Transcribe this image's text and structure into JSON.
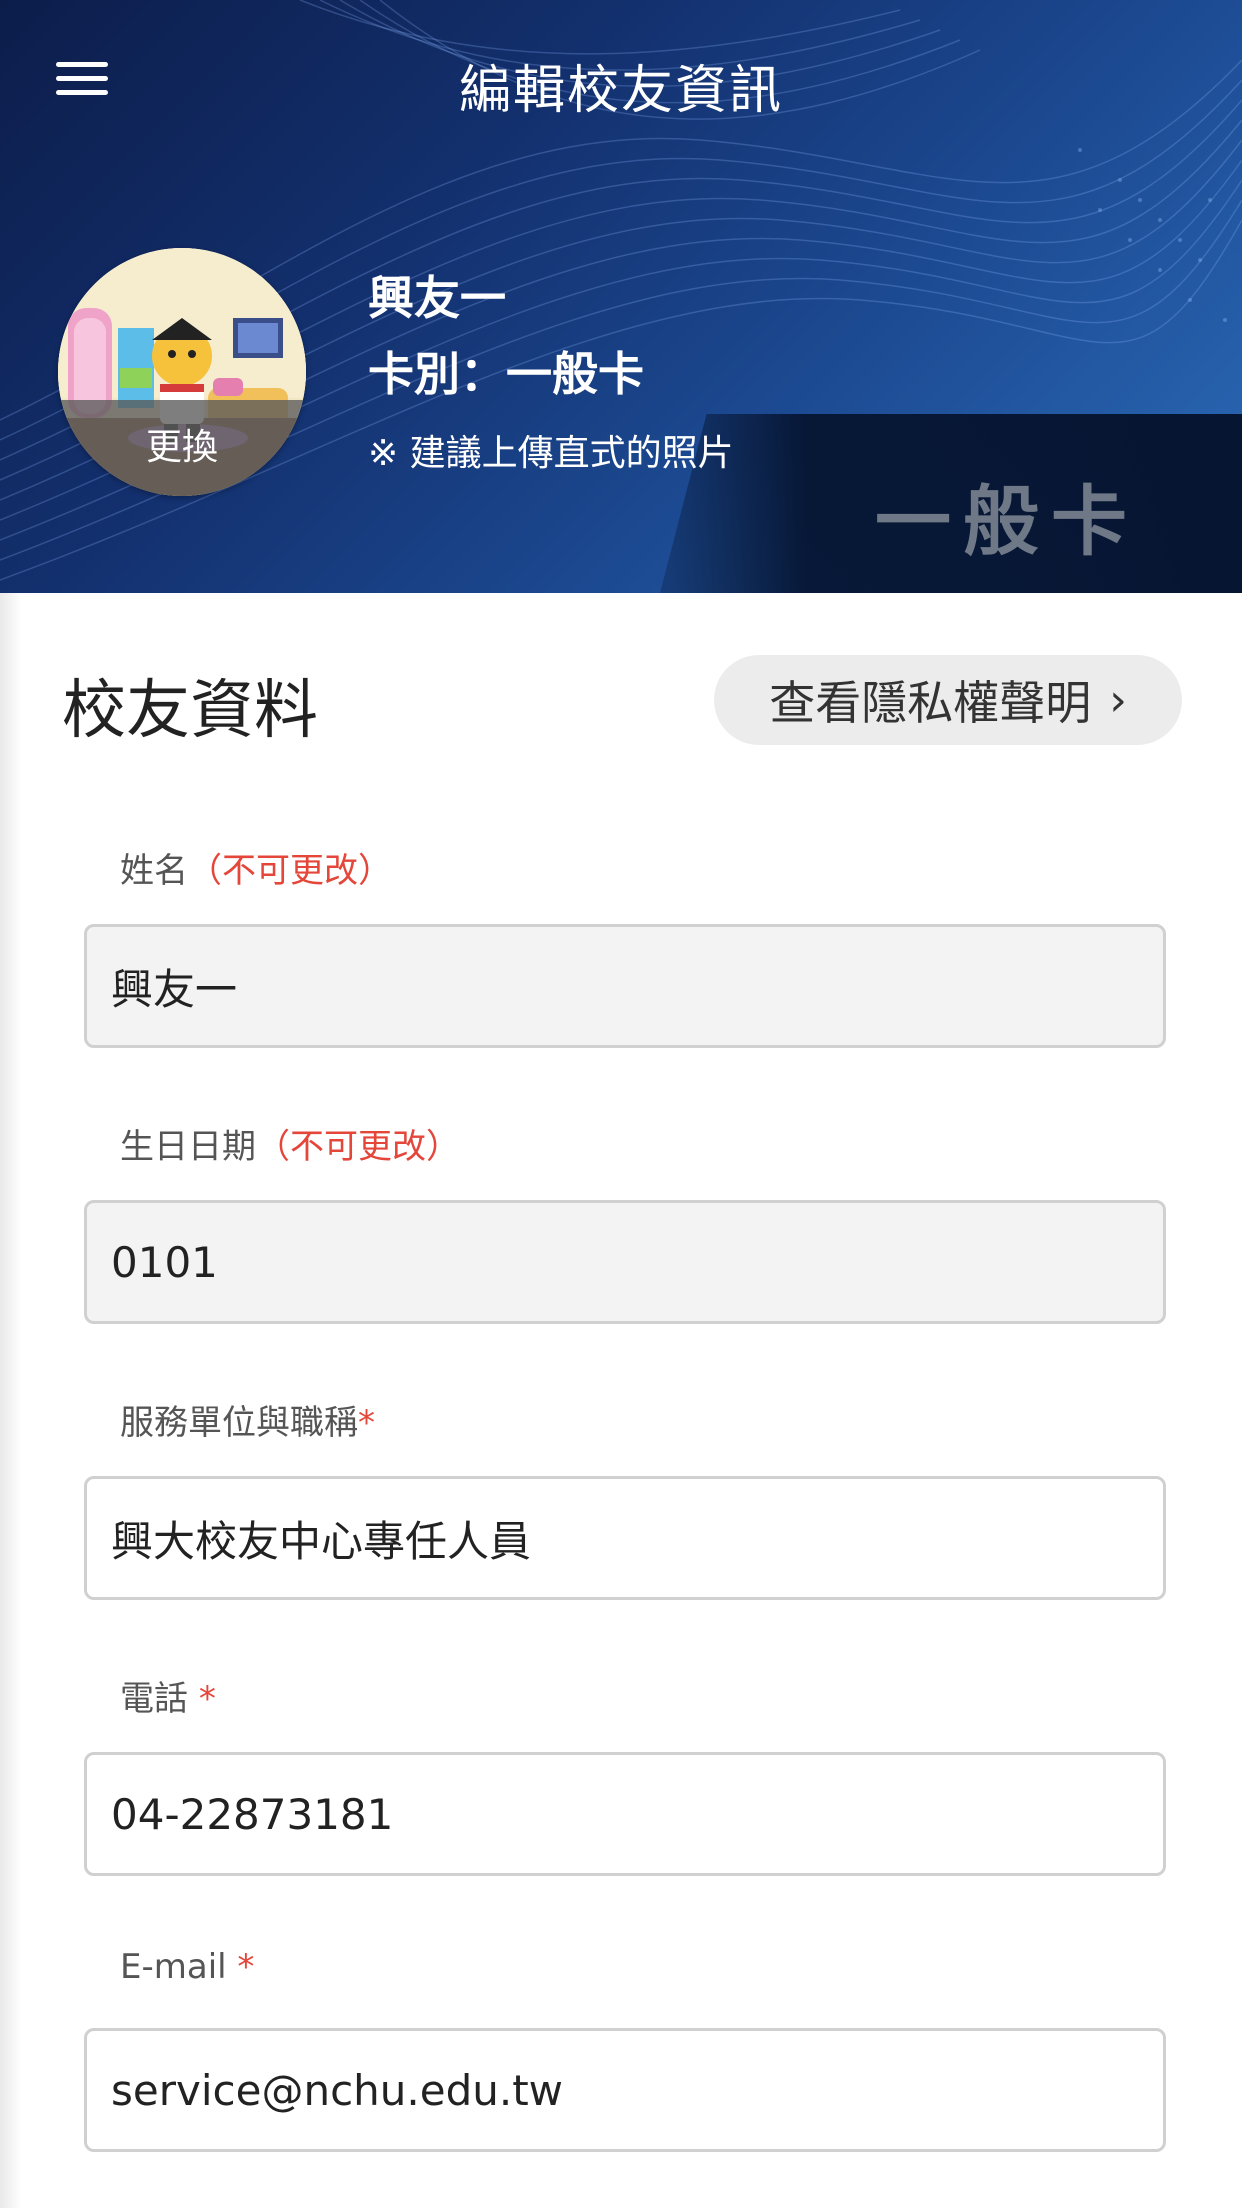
{
  "header": {
    "title": "編輯校友資訊",
    "menu_icon": "hamburger-menu-icon"
  },
  "profile": {
    "name": "興友一",
    "card_type": "卡別：一般卡",
    "hint": "※ 建議上傳直式的照片",
    "avatar_change": "更換",
    "card_tag": "一般卡"
  },
  "section": {
    "title": "校友資料",
    "privacy_button": "查看隱私權聲明",
    "privacy_chevron": "›"
  },
  "fields": [
    {
      "label": "姓名",
      "note": "（不可更改）",
      "value": "興友一",
      "readonly": true
    },
    {
      "label": "生日日期",
      "note": "（不可更改）",
      "value": "0101",
      "readonly": true
    },
    {
      "label": "服務單位與職稱",
      "note": "*",
      "value": "興大校友中心專任人員",
      "readonly": false
    },
    {
      "label": "電話 ",
      "note": "*",
      "value": "04-22873181",
      "readonly": false
    },
    {
      "label": "E-mail ",
      "note": "*",
      "value": "service@nchu.edu.tw",
      "readonly": false
    }
  ],
  "colors": {
    "required": "#e4463a",
    "header_dark": "#0c1d4a",
    "header_light": "#2c6bb8"
  }
}
